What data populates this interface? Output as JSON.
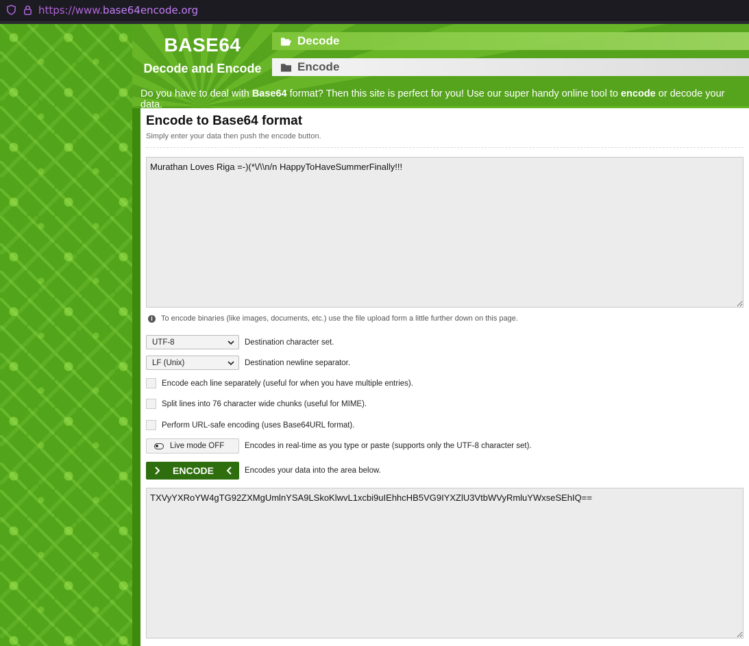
{
  "browser": {
    "url_protocol": "https://www.",
    "url_host": "base64encode.org"
  },
  "header": {
    "logo_title": "BASE64",
    "logo_subtitle": "Decode and Encode",
    "tab_decode": "Decode",
    "tab_encode": "Encode",
    "tagline_1": "Do you have to deal with ",
    "tagline_bold_1": "Base64",
    "tagline_2": " format? Then this site is perfect for you! Use our super handy online tool to ",
    "tagline_bold_2": "encode",
    "tagline_3": " or decode your data."
  },
  "main": {
    "title": "Encode to Base64 format",
    "subtitle": "Simply enter your data then push the encode button.",
    "input_value": "Murathan Loves Riga =-)(*\\/\\\\n/n HappyToHaveSummerFinally!!!",
    "binary_note": "To encode binaries (like images, documents, etc.) use the file upload form a little further down on this page.",
    "charset_value": "UTF-8",
    "charset_label": "Destination character set.",
    "newline_value": "LF (Unix)",
    "newline_label": "Destination newline separator.",
    "option_each_line": "Encode each line separately (useful for when you have multiple entries).",
    "option_split": "Split lines into 76 character wide chunks (useful for MIME).",
    "option_urlsafe": "Perform URL-safe encoding (uses Base64URL format).",
    "live_mode_label": "Live mode OFF",
    "live_mode_desc": "Encodes in real-time as you type or paste (supports only the UTF-8 character set).",
    "encode_label": "ENCODE",
    "encode_desc": "Encodes your data into the area below.",
    "output_value": "TXVyYXRoYW4gTG92ZXMgUmlnYSA9LSkoKlwvL1xcbi9uIEhhcHB5VG9IYXZlU3VtbWVyRmluYWxseSEhIQ=="
  },
  "colors": {
    "brand_green": "#5aa81f",
    "button_dark_green": "#2f6e0e"
  }
}
